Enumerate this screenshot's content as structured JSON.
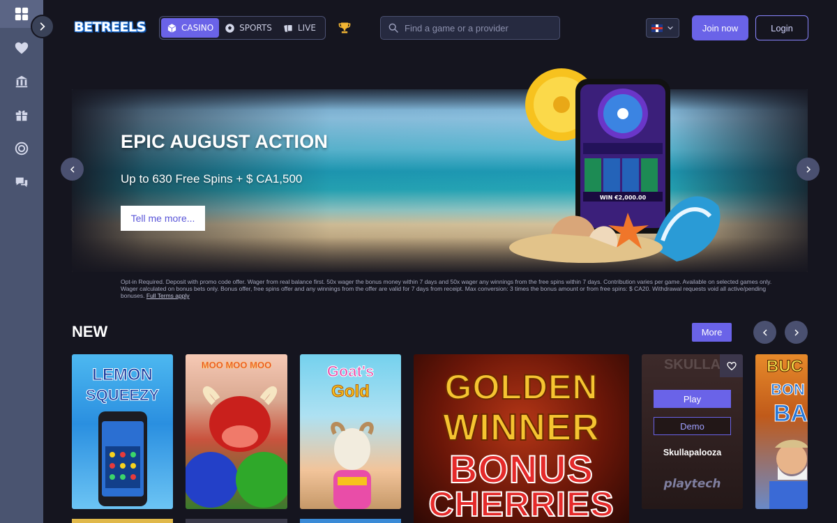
{
  "brand": {
    "logo_text": "BETREELS",
    "accent": "#6a63e8"
  },
  "sidebar": {
    "items": [
      {
        "icon": "grid-icon"
      },
      {
        "icon": "heart-icon"
      },
      {
        "icon": "bank-icon"
      },
      {
        "icon": "gift-icon"
      },
      {
        "icon": "target-icon"
      },
      {
        "icon": "chat-icon"
      }
    ]
  },
  "header": {
    "tabs": [
      {
        "label": "CASINO",
        "icon": "dice-icon",
        "active": true
      },
      {
        "label": "SPORTS",
        "icon": "soccer-ball-icon",
        "active": false
      },
      {
        "label": "LIVE",
        "icon": "cards-icon",
        "active": false
      }
    ],
    "search_placeholder": "Find a game or a provider",
    "join_label": "Join now",
    "login_label": "Login"
  },
  "hero": {
    "title": "EPIC AUGUST ACTION",
    "subtitle": "Up to 630 Free Spins + $ CA1,500",
    "cta_label": "Tell me more...",
    "disclaimer": "Opt-in Required. Deposit with promo code offer. Wager from real balance first. 50x wager the bonus money within 7 days and 50x wager any winnings from the free spins within 7 days. Contribution varies per game. Available on selected games only. Wager calculated on bonus bets only. Bonus offer, free spins offer and any winnings from the offer are valid for 7 days from receipt. Max conversion: 3 times the bonus amount or from free spins: $ CA20. Withdrawal requests void all active/pending bonuses.",
    "terms_link": "Full Terms apply",
    "phone_win_text": "WIN €2,000.00"
  },
  "new_section": {
    "title": "NEW",
    "more_label": "More",
    "games": [
      {
        "title_line1": "LEMON",
        "title_line2": "SQUEEZY"
      },
      {
        "title_line1": "MOO MOO MOO"
      },
      {
        "title_line1": "Goat's",
        "title_line2": "Gold"
      },
      {
        "title_line1": "GOLDEN",
        "title_line2": "WINNER",
        "title_line3": "BONUS",
        "title_line4": "CHERRIES"
      },
      {
        "title_line1": "SKULLA",
        "name": "Skullapalooza",
        "provider": "playtech",
        "play_label": "Play",
        "demo_label": "Demo"
      },
      {
        "title_line1": "BUC",
        "title_line2": "BON",
        "title_line3": "BA"
      }
    ]
  }
}
